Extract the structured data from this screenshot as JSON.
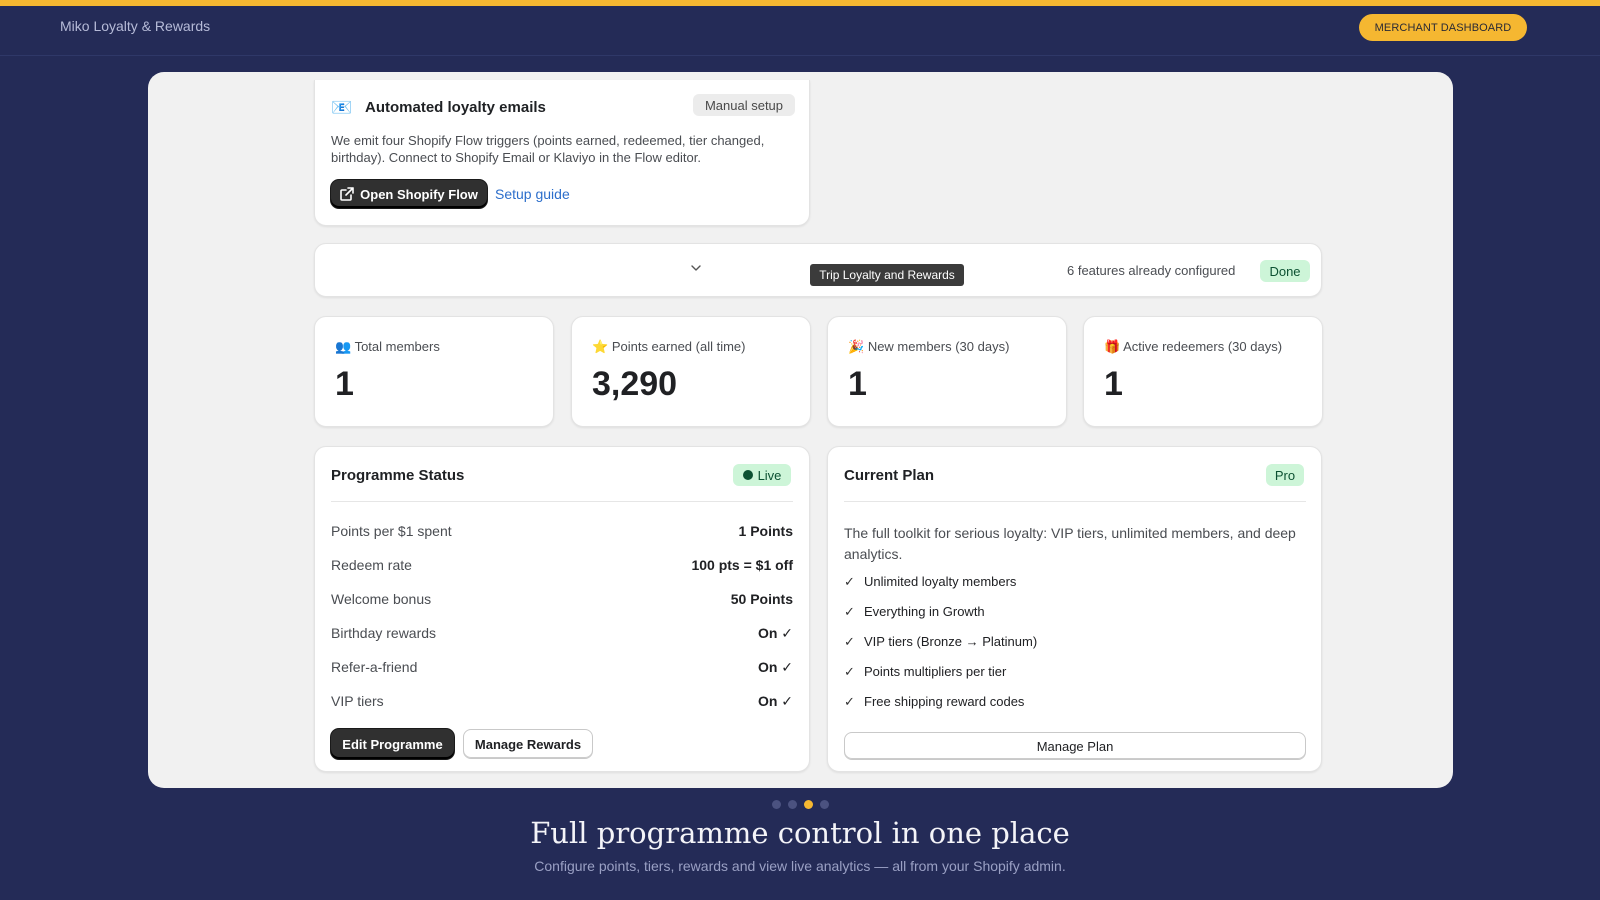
{
  "header": {
    "brand": "Miko Loyalty & Rewards",
    "merchant_button": "MERCHANT DASHBOARD"
  },
  "email_card": {
    "icon": "📧",
    "title": "Automated loyalty emails",
    "badge": "Manual setup",
    "description": "We emit four Shopify Flow triggers (points earned, redeemed, tier changed, birthday). Connect to Shopify Email or Klaviyo in the Flow editor.",
    "open_button": "Open Shopify Flow",
    "setup_link": "Setup guide"
  },
  "features_bar": {
    "tooltip": "Trip Loyalty and Rewards",
    "configured_text": "6 features already configured",
    "done_badge": "Done"
  },
  "stats": [
    {
      "icon": "👥",
      "label": "Total members",
      "value": "1"
    },
    {
      "icon": "⭐",
      "label": "Points earned (all time)",
      "value": "3,290"
    },
    {
      "icon": "🎉",
      "label": "New members (30 days)",
      "value": "1"
    },
    {
      "icon": "🎁",
      "label": "Active redeemers (30 days)",
      "value": "1"
    }
  ],
  "programme_status": {
    "title": "Programme Status",
    "badge": "Live",
    "rows": [
      {
        "label": "Points per $1 spent",
        "value": "1 Points"
      },
      {
        "label": "Redeem rate",
        "value": "100 pts = $1 off"
      },
      {
        "label": "Welcome bonus",
        "value": "50 Points"
      },
      {
        "label": "Birthday rewards",
        "value": "On ✓"
      },
      {
        "label": "Refer-a-friend",
        "value": "On ✓"
      },
      {
        "label": "VIP tiers",
        "value": "On ✓"
      }
    ],
    "edit_button": "Edit Programme",
    "manage_rewards_button": "Manage Rewards"
  },
  "current_plan": {
    "title": "Current Plan",
    "badge": "Pro",
    "description": "The full toolkit for serious loyalty: VIP tiers, unlimited members, and deep analytics.",
    "features": [
      "Unlimited loyalty members",
      "Everything in Growth",
      "VIP tiers (Bronze → Platinum)",
      "Points multipliers per tier",
      "Free shipping reward codes"
    ],
    "manage_button": "Manage Plan"
  },
  "carousel": {
    "total_slides": 4,
    "active_slide": 3
  },
  "caption": {
    "headline": "Full programme control in one place",
    "subline": "Configure points, tiers, rewards and view live analytics — all from your Shopify admin."
  },
  "colors": {
    "background": "#242b57",
    "accent": "#f5b731",
    "success_badge": "#cdf5d8",
    "link": "#2c6ecb"
  }
}
